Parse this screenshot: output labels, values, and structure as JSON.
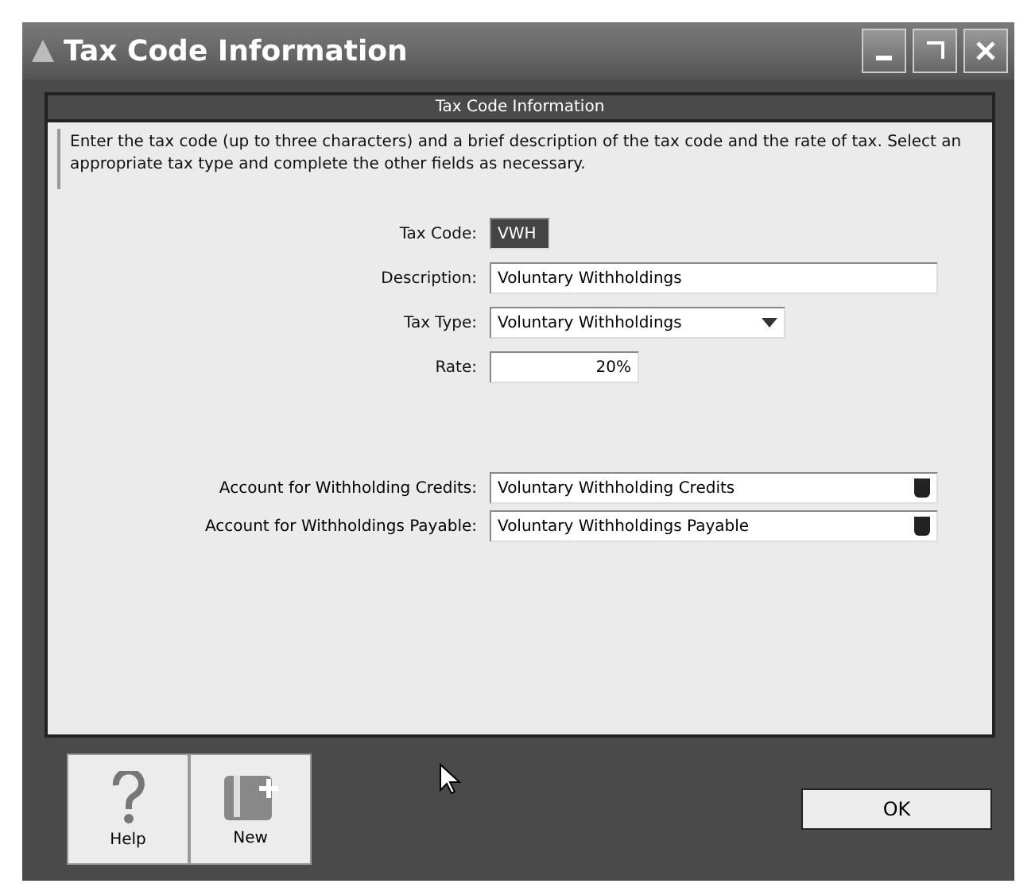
{
  "window": {
    "title": "Tax Code Information"
  },
  "panel": {
    "title": "Tax Code Information",
    "instructions": "Enter the tax code (up to three characters) and a brief description of the tax code and the rate of tax. Select an appropriate tax type and complete the other fields as necessary."
  },
  "fields": [
    {
      "kind": "text",
      "label": "Tax Code:",
      "value": "VWH"
    },
    {
      "kind": "wide",
      "label": "Description:",
      "value": "Voluntary Withholdings"
    },
    {
      "kind": "select",
      "label": "Tax Type:",
      "value": "Voluntary Withholdings"
    },
    {
      "kind": "rate",
      "label": "Rate:",
      "value": "20%"
    }
  ],
  "accounts": [
    {
      "label": "Account for Withholding Credits:",
      "value": "Voluntary Withholding Credits"
    },
    {
      "label": "Account for Withholdings Payable:",
      "value": "Voluntary Withholdings Payable"
    }
  ],
  "tools": [
    {
      "kind": "help",
      "label": "Help"
    },
    {
      "kind": "new",
      "label": "New"
    }
  ],
  "ok": "OK"
}
